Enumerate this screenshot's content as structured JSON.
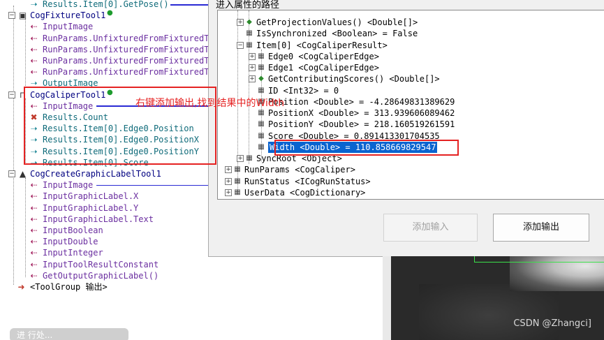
{
  "left_tree": {
    "rows": [
      {
        "kind": "output",
        "text": "Results.Item[0].GetPose()",
        "depth": 2
      },
      {
        "kind": "tool",
        "text": "CogFixtureTool1",
        "depth": 1
      },
      {
        "kind": "input",
        "text": "InputImage",
        "depth": 2
      },
      {
        "kind": "input",
        "text": "RunParams.UnfixturedFromFixturedT",
        "depth": 2
      },
      {
        "kind": "input",
        "text": "RunParams.UnfixturedFromFixturedT",
        "depth": 2
      },
      {
        "kind": "input",
        "text": "RunParams.UnfixturedFromFixturedT",
        "depth": 2
      },
      {
        "kind": "input",
        "text": "RunParams.UnfixturedFromFixturedT",
        "depth": 2
      },
      {
        "kind": "output",
        "text": "OutputImage",
        "depth": 2
      },
      {
        "kind": "tool",
        "text": "CogCaliperTool1",
        "depth": 1
      },
      {
        "kind": "input",
        "text": "InputImage",
        "depth": 2
      },
      {
        "kind": "output",
        "text": "Results.Count",
        "depth": 2
      },
      {
        "kind": "output",
        "text": "Results.Item[0].Edge0.Position",
        "depth": 2
      },
      {
        "kind": "output",
        "text": "Results.Item[0].Edge0.PositionX",
        "depth": 2
      },
      {
        "kind": "output",
        "text": "Results.Item[0].Edge0.PositionY",
        "depth": 2
      },
      {
        "kind": "output",
        "text": "Results.Item[0].Score",
        "depth": 2
      },
      {
        "kind": "tool",
        "text": "CogCreateGraphicLabelTool1",
        "depth": 1
      },
      {
        "kind": "input",
        "text": "InputImage",
        "depth": 2
      },
      {
        "kind": "input",
        "text": "InputGraphicLabel.X",
        "depth": 2
      },
      {
        "kind": "input",
        "text": "InputGraphicLabel.Y",
        "depth": 2
      },
      {
        "kind": "input",
        "text": "InputGraphicLabel.Text",
        "depth": 2
      },
      {
        "kind": "input",
        "text": "InputBoolean",
        "depth": 2
      },
      {
        "kind": "input",
        "text": "InputDouble",
        "depth": 2
      },
      {
        "kind": "input",
        "text": "InputInteger",
        "depth": 2
      },
      {
        "kind": "input",
        "text": "InputToolResultConstant",
        "depth": 2
      },
      {
        "kind": "input",
        "text": "GetOutputGraphicLabel()",
        "depth": 2
      },
      {
        "kind": "group",
        "text": "<ToolGroup 输出>",
        "depth": 1
      }
    ]
  },
  "dialog": {
    "title": "进入属性的路径",
    "rows": [
      {
        "exp": "+",
        "icon": "method",
        "text": "GetProjectionValues() <Double[]>",
        "indent": 2
      },
      {
        "exp": "",
        "icon": "prop",
        "text": "IsSynchronized <Boolean> = False",
        "indent": 2
      },
      {
        "exp": "-",
        "icon": "prop",
        "text": "Item[0] <CogCaliperResult>",
        "indent": 2
      },
      {
        "exp": "+",
        "icon": "prop",
        "text": "Edge0 <CogCaliperEdge>",
        "indent": 3
      },
      {
        "exp": "+",
        "icon": "prop",
        "text": "Edge1 <CogCaliperEdge>",
        "indent": 3
      },
      {
        "exp": "+",
        "icon": "method",
        "text": "GetContributingScores() <Double[]>",
        "indent": 3
      },
      {
        "exp": "",
        "icon": "prop",
        "text": "ID <Int32> = 0",
        "indent": 3
      },
      {
        "exp": "",
        "icon": "prop",
        "text": "Position <Double> = -4.28649831389629",
        "indent": 3
      },
      {
        "exp": "",
        "icon": "prop",
        "text": "PositionX <Double> = 313.939606089462",
        "indent": 3
      },
      {
        "exp": "",
        "icon": "prop",
        "text": "PositionY <Double> = 218.160519261591",
        "indent": 3
      },
      {
        "exp": "",
        "icon": "prop",
        "text": "Score <Double> = 0.891413301704535",
        "indent": 3
      },
      {
        "exp": "",
        "icon": "prop",
        "text": "Width <Double> = 110.858669829547",
        "indent": 3,
        "selected": true
      },
      {
        "exp": "+",
        "icon": "prop",
        "text": "SyncRoot <Object>",
        "indent": 2
      },
      {
        "exp": "+",
        "icon": "prop",
        "text": "RunParams <CogCaliper>",
        "indent": 1
      },
      {
        "exp": "+",
        "icon": "prop",
        "text": "RunStatus <ICogRunStatus>",
        "indent": 1
      },
      {
        "exp": "+",
        "icon": "prop",
        "text": "UserData <CogDictionary>",
        "indent": 1
      }
    ],
    "add_input_label": "添加输入",
    "add_output_label": "添加输出"
  },
  "annotation": {
    "text": "右键添加输出,找到结果中的Width",
    "color": "#e52222"
  },
  "viewer": {
    "watermark": "CSDN @Zhangci]"
  },
  "bottom_chip": {
    "text": "进 行处..."
  },
  "colors": {
    "selection": "#0a64d0",
    "tool_text": "#000080",
    "terminal_text": "#6b2fa0",
    "output_text": "#0f6b7a",
    "link_line": "#2a2ad4",
    "green_roi": "#3be04a"
  }
}
